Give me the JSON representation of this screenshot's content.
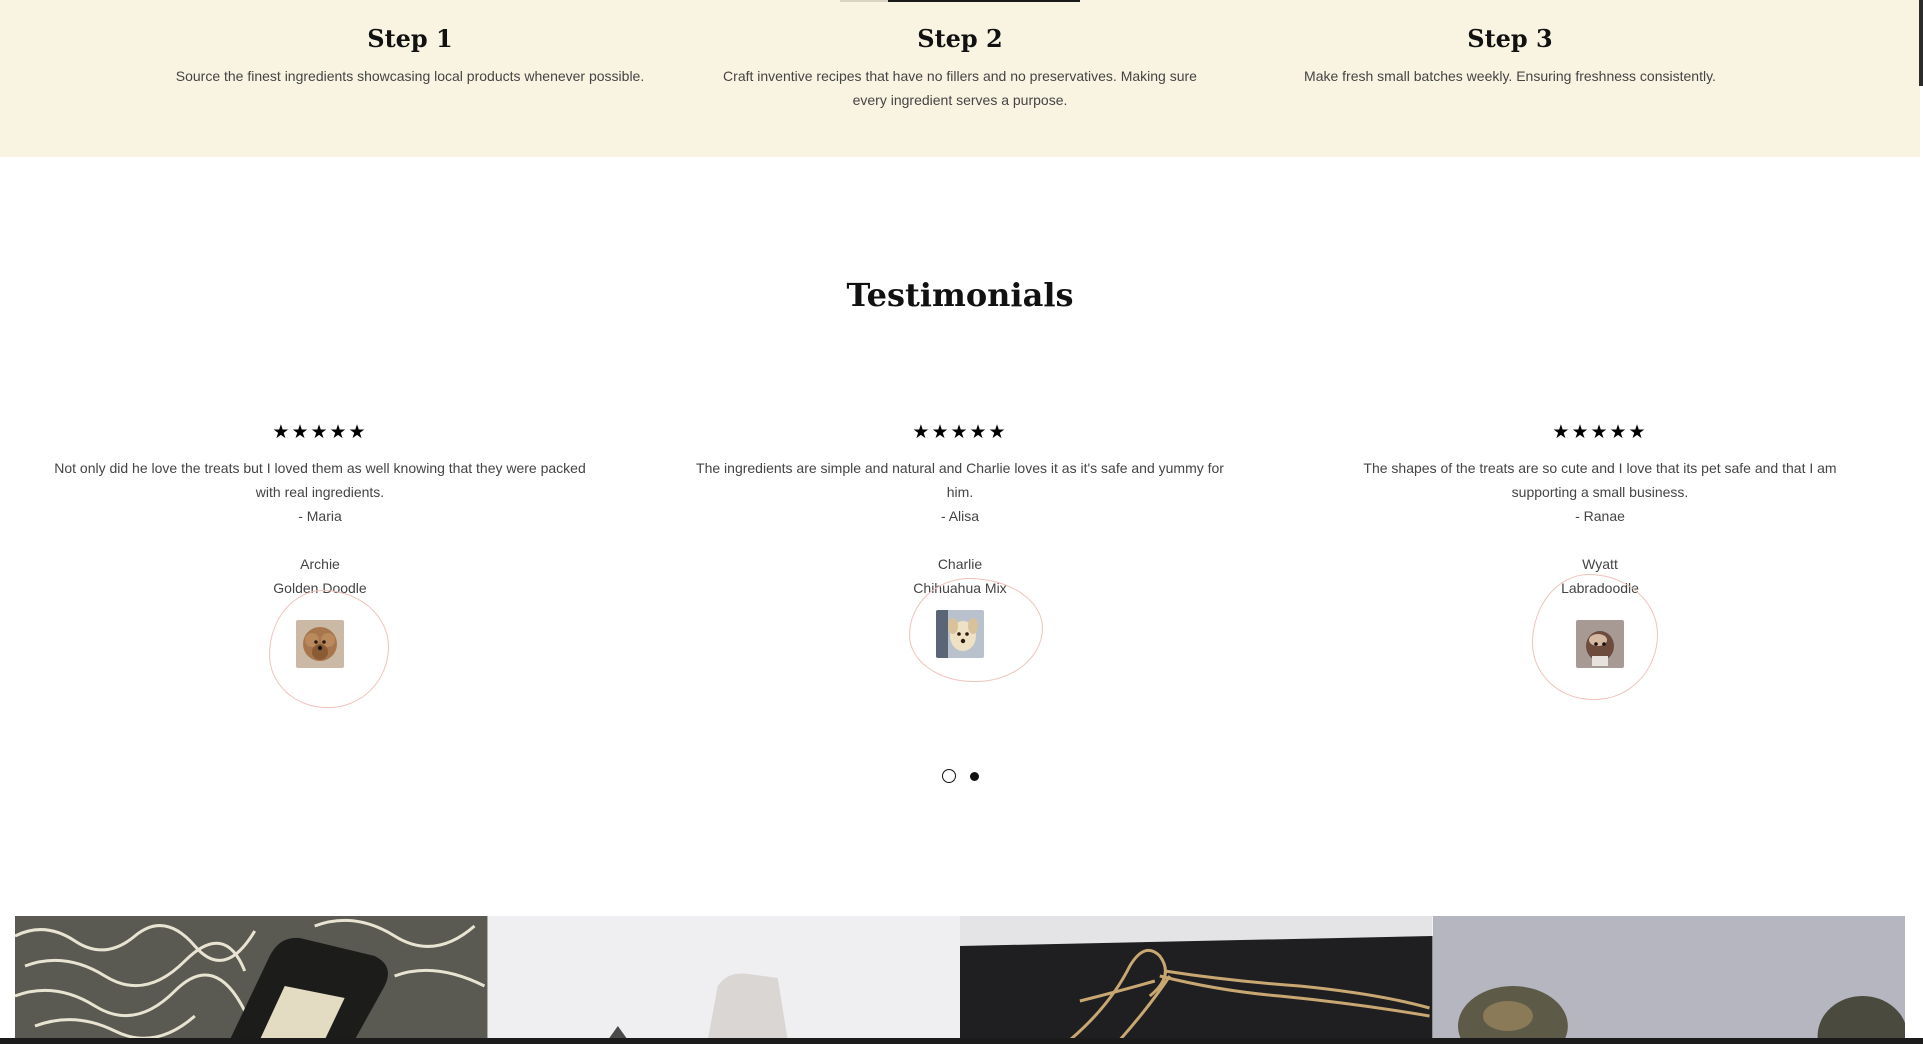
{
  "steps": [
    {
      "title": "Step 1",
      "text": "Source the finest ingredients showcasing local products whenever possible."
    },
    {
      "title": "Step 2",
      "text": "Craft inventive recipes that have no fillers and no preservatives. Making sure every ingredient serves a purpose."
    },
    {
      "title": "Step 3",
      "text": "Make fresh small batches weekly. Ensuring freshness consistently."
    }
  ],
  "testimonials": {
    "title": "Testimonials",
    "items": [
      {
        "stars": "★★★★★",
        "rating": 5,
        "quote": "Not only did he love the treats but I loved them as well knowing that they were packed with real ingredients.",
        "author": "- Maria",
        "pet_name": "Archie",
        "pet_breed": "Golden Doodle"
      },
      {
        "stars": "★★★★★",
        "rating": 5,
        "quote": "The ingredients are simple and natural and Charlie loves it as it's safe and yummy for him.",
        "author": "- Alisa",
        "pet_name": "Charlie",
        "pet_breed": "Chihuahua Mix"
      },
      {
        "stars": "★★★★★",
        "rating": 5,
        "quote": "The shapes of the treats are so cute and I love that its pet safe and that I am supporting a small business.",
        "author": "- Ranae",
        "pet_name": "Wyatt",
        "pet_breed": "Labradoodle"
      }
    ],
    "pagination": {
      "pages": 2,
      "active": 2
    }
  },
  "gallery": {
    "tiles": [
      "packaged-treat-tin-photo",
      "treat-jar-photo",
      "gift-box-with-twine-photo",
      "dog-treats-photo"
    ]
  },
  "colors": {
    "steps_background": "#f9f4e2",
    "scribble": "#efc3bc",
    "star": "#000000"
  }
}
